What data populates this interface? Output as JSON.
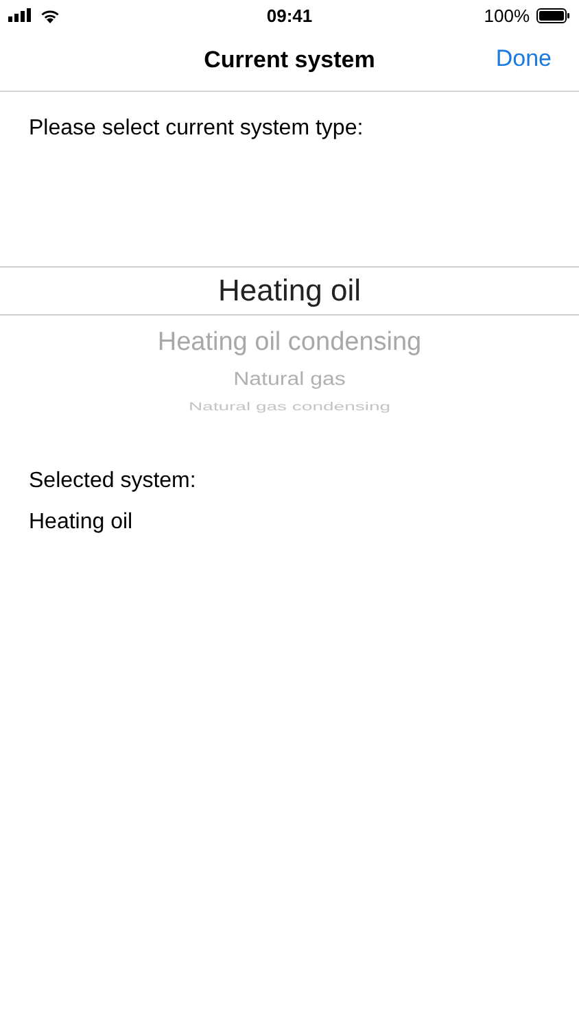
{
  "status_bar": {
    "time": "09:41",
    "battery": "100%"
  },
  "nav": {
    "title": "Current system",
    "done": "Done"
  },
  "prompt": "Please select current system type:",
  "picker": [
    {
      "label": "Heating oil",
      "selected": true
    },
    {
      "label": "Heating oil condensing",
      "selected": false
    },
    {
      "label": "Natural gas",
      "selected": false
    },
    {
      "label": "Natural gas condensing",
      "selected": false
    }
  ],
  "selected_label": "Selected system:",
  "selected_value": "Heating oil"
}
